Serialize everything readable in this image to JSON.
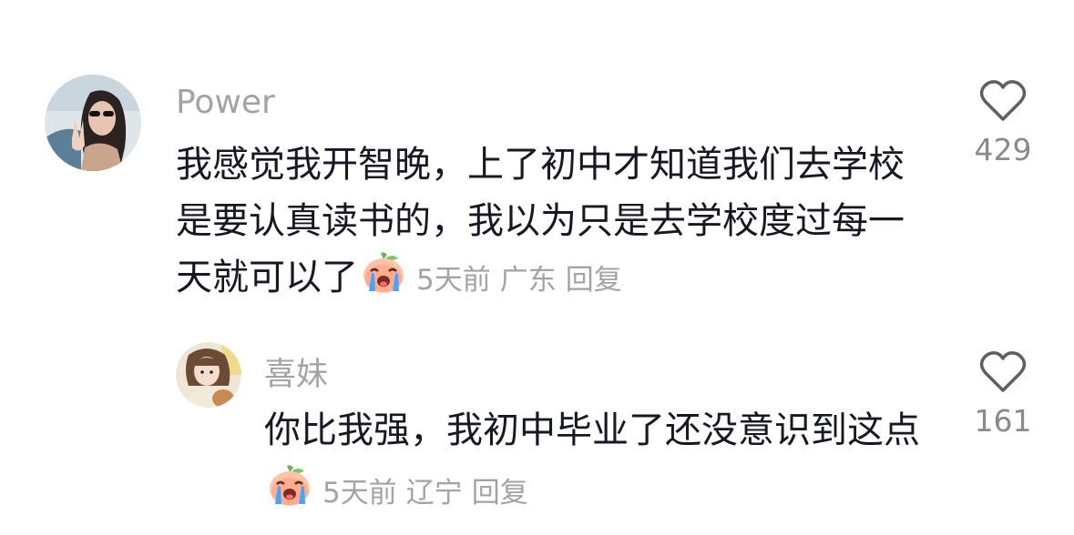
{
  "comments": [
    {
      "username": "Power",
      "text": "我感觉我开智晚，上了初中才知道我们去学校是要认真读书的，我以为只是去学校度过每一天就可以了",
      "emoji": "crying-peach-emoji",
      "time": "5天前",
      "location": "广东",
      "reply_label": "回复",
      "likes": "429",
      "like_icon": "heart-outline-icon"
    },
    {
      "username": "喜妹",
      "text": "你比我强，我初中毕业了还没意识到这点",
      "emoji": "crying-peach-emoji",
      "time": "5天前",
      "location": "辽宁",
      "reply_label": "回复",
      "likes": "161",
      "like_icon": "heart-outline-icon"
    }
  ],
  "colors": {
    "text": "#161823",
    "secondary": "#a3a3a3",
    "background": "#ffffff"
  }
}
